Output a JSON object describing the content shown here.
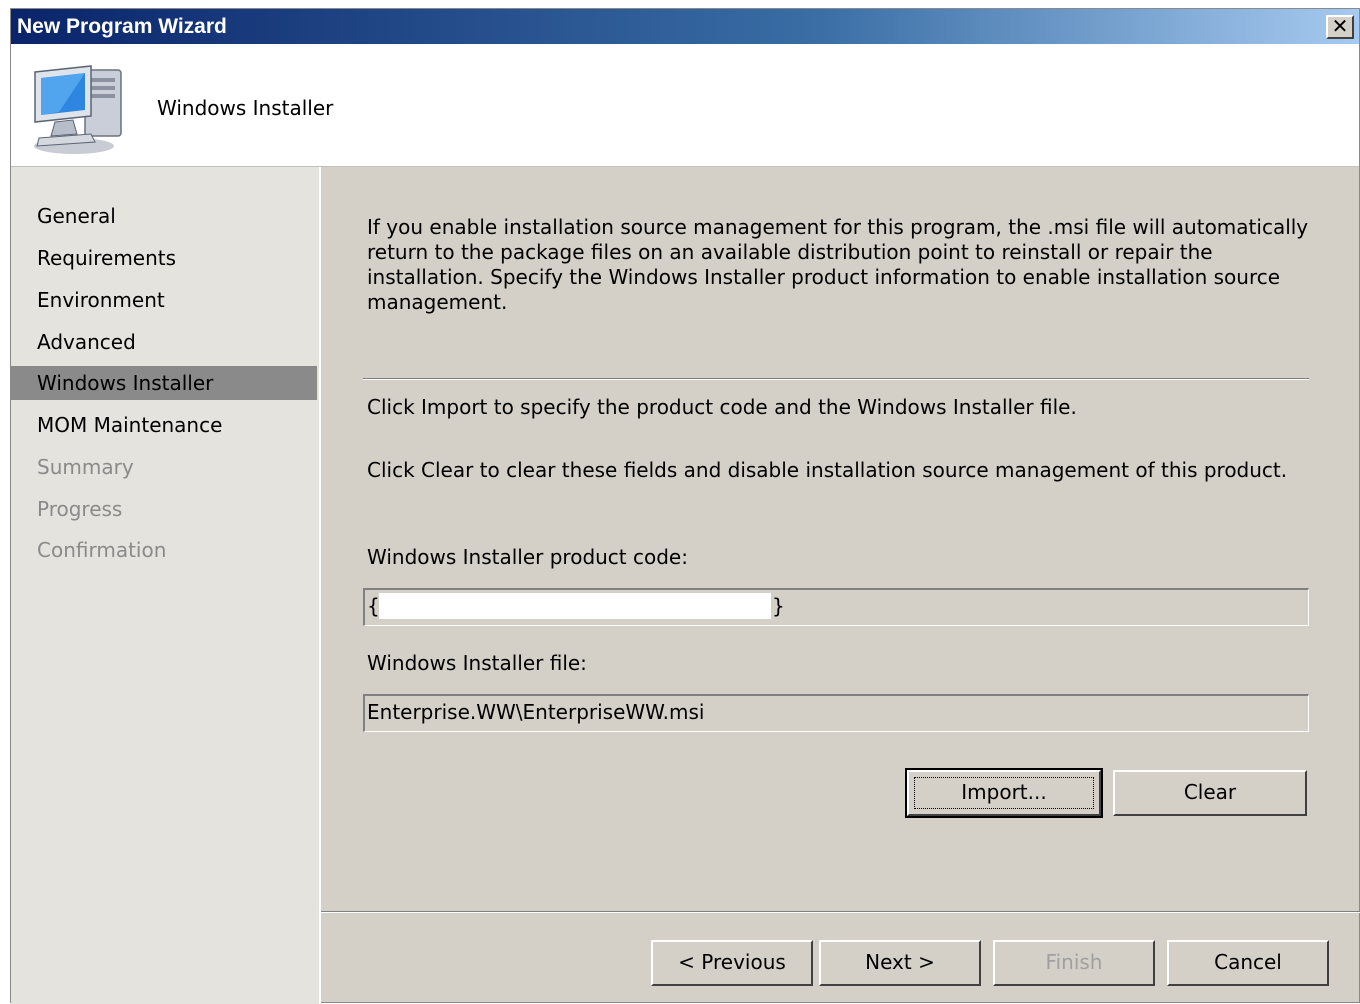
{
  "window": {
    "title": "New Program Wizard",
    "close_symbol": "✕"
  },
  "header": {
    "icon": "computer-icon",
    "title": "Windows Installer"
  },
  "sidebar": {
    "items": [
      {
        "label": "General",
        "state": "enabled"
      },
      {
        "label": "Requirements",
        "state": "enabled"
      },
      {
        "label": "Environment",
        "state": "enabled"
      },
      {
        "label": "Advanced",
        "state": "enabled"
      },
      {
        "label": "Windows Installer",
        "state": "selected"
      },
      {
        "label": "MOM Maintenance",
        "state": "enabled"
      },
      {
        "label": "Summary",
        "state": "disabled"
      },
      {
        "label": "Progress",
        "state": "disabled"
      },
      {
        "label": "Confirmation",
        "state": "disabled"
      }
    ]
  },
  "content": {
    "intro": "If you enable installation source management for this program, the .msi file will automatically return to the package files on an available distribution point to reinstall or repair the installation. Specify the Windows Installer product information to enable installation source management.",
    "import_hint": "Click Import to specify the product code and the Windows Installer file.",
    "clear_hint": "Click Clear to clear these fields and disable installation source management of this product.",
    "product_code_label": "Windows Installer product code:",
    "product_code_open": "{",
    "product_code_close": "}",
    "file_label": "Windows Installer file:",
    "file_value": "Enterprise.WW\\EnterpriseWW.msi",
    "import_button": "Import...",
    "clear_button": "Clear"
  },
  "footer": {
    "previous_button": "< Previous",
    "next_button": "Next >",
    "finish_button": "Finish",
    "cancel_button": "Cancel"
  }
}
